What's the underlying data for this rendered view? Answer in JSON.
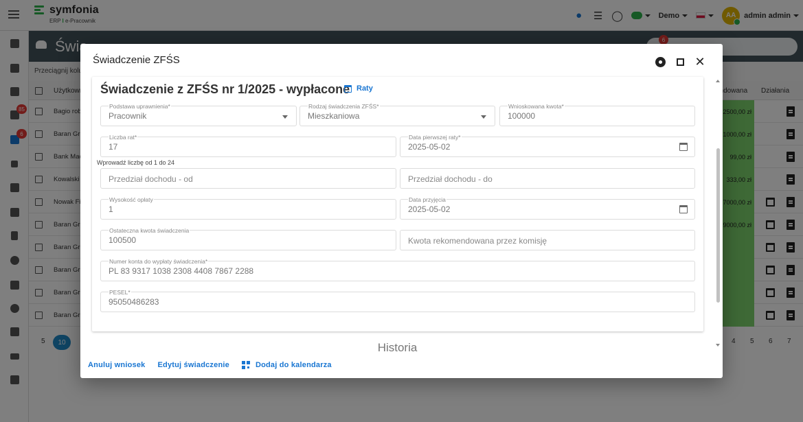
{
  "app": {
    "logo_name": "symfonia",
    "logo_sub_a": "ERP",
    "logo_sub_sep": "I",
    "logo_sub_b": "e-Pracownik",
    "demo_label": "Demo",
    "user_initials": "AA",
    "user_name": "admin admin",
    "sidebar_badges": [
      "85",
      "6"
    ],
    "page_title": "Świadczenia ZFŚS",
    "page_title_visible": "Świa",
    "header_badge": "6",
    "drag_hint": "Przeciągnij kolu",
    "col_user": "Użytkown",
    "col_amount": "endowana",
    "col_actions": "Działania",
    "rows": [
      {
        "name": "Bagio rob",
        "amount": "2500,00 zł"
      },
      {
        "name": "Baran Gr",
        "amount": "1000,00 zł"
      },
      {
        "name": "Bank Mac",
        "amount": "99,00 zł"
      },
      {
        "name": "Kowalski",
        "amount": "333,00 zł"
      },
      {
        "name": "Nowak Fi",
        "amount": "7000,00 zł"
      },
      {
        "name": "Baran Gr",
        "amount": "9000,00 zł"
      },
      {
        "name": "Baran Gr",
        "amount": ""
      },
      {
        "name": "Baran Gr",
        "amount": ""
      },
      {
        "name": "Baran Gr",
        "amount": ""
      },
      {
        "name": "Baran Gr",
        "amount": ""
      }
    ],
    "pager": {
      "size_a": "5",
      "size_active": "10",
      "pages": [
        "4",
        "5",
        "6",
        "7"
      ]
    }
  },
  "modal": {
    "title": "Świadczenie ZFŚS",
    "heading": "Świadczenie z ZFŚS nr 1/2025 - wypłacone",
    "raty_label": "Raty",
    "fields": {
      "podstawa": {
        "label": "Podstawa uprawnienia*",
        "value": "Pracownik"
      },
      "rodzaj": {
        "label": "Rodzaj świadczenia ZFŚS*",
        "value": "Mieszkaniowa"
      },
      "kwota": {
        "label": "Wnioskowana kwota*",
        "value": "100000"
      },
      "liczba_rat": {
        "label": "Liczba rat*",
        "value": "17"
      },
      "data_pierwszej": {
        "label": "Data pierwszej raty*",
        "value": "2025-05-02"
      },
      "hint": "Wprowadź liczbę od 1 do 24",
      "dochod_od": {
        "placeholder": "Przedział dochodu - od"
      },
      "dochod_do": {
        "placeholder": "Przedział dochodu - do"
      },
      "wysokosc": {
        "label": "Wysokość opłaty",
        "value": "1"
      },
      "data_przyjecia": {
        "label": "Data przyjęcia",
        "value": "2025-05-02"
      },
      "ostateczna": {
        "label": "Ostateczna kwota świadczenia",
        "value": "100500"
      },
      "rekomendowana": {
        "placeholder": "Kwota rekomendowana przez komisję"
      },
      "konto": {
        "label": "Numer konta do wypłaty świadczenia*",
        "value": "PL 83 9317 1038 2308 4408 7867 2288"
      },
      "pesel": {
        "label": "PESEL*",
        "value": "95050486283"
      }
    },
    "history_label": "Historia",
    "footer": {
      "cancel": "Anuluj wniosek",
      "edit": "Edytuj świadczenie",
      "calendar": "Dodaj do kalendarza"
    }
  }
}
